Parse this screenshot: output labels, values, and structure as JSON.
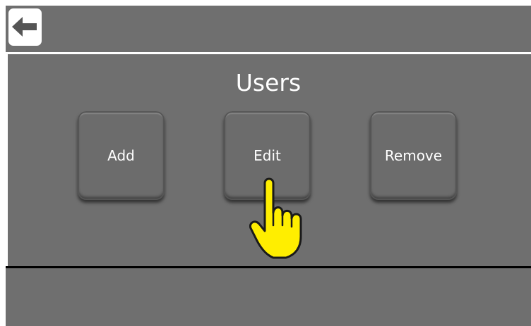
{
  "screen": {
    "title": "Users",
    "back_icon": "arrow-left-icon"
  },
  "buttons": [
    {
      "label": "Add"
    },
    {
      "label": "Edit"
    },
    {
      "label": "Remove"
    }
  ],
  "pointer": {
    "icon": "pointing-hand-icon",
    "target": "Edit"
  },
  "colors": {
    "background": "#6f6f6f",
    "divider_light": "#ffffff",
    "divider_dark": "#000000",
    "hand_fill": "#ffee00"
  }
}
